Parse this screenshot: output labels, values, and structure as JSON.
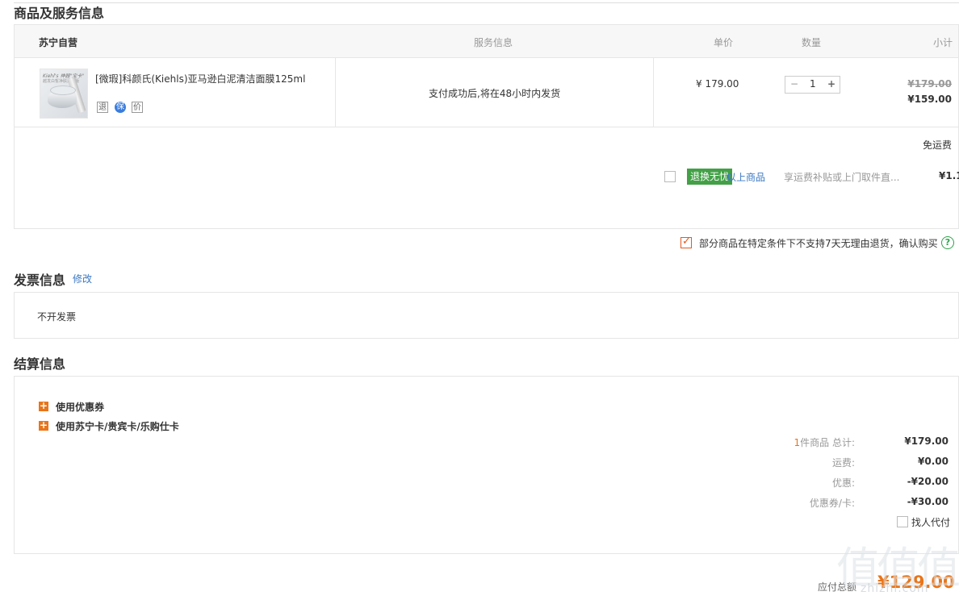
{
  "sections": {
    "goods_title": "商品及服务信息",
    "invoice_title": "发票信息",
    "invoice_edit": "修改",
    "settle_title": "结算信息"
  },
  "table": {
    "headers": [
      "苏宁自营",
      "服务信息",
      "单价",
      "数量",
      "小计"
    ]
  },
  "item": {
    "thumb_brand": "Kiehl's 神器\"宝卡\"",
    "thumb_sub": "越发白皙净肤透力版",
    "name": "[微瑕]科颜氏(Kiehls)亚马逊白泥清洁面膜125ml",
    "tags": [
      "退",
      "保",
      "价"
    ],
    "service": "支付成功后,将在48小时内发货",
    "unit_price": "¥ 179.00",
    "qty_minus": "−",
    "qty": "1",
    "qty_plus": "+",
    "orig_subtotal": "¥179.00",
    "subtotal": "¥159.00"
  },
  "freight": {
    "label": "免运费",
    "badge": "退换无忧",
    "product_link": "以上商品",
    "desc": "享运费补贴或上门取件直...",
    "price": "¥1.1"
  },
  "notice": {
    "text": "部分商品在特定条件下不支持7天无理由退货，确认购买",
    "help": "?"
  },
  "invoice": {
    "value": "不开发票"
  },
  "settle": {
    "coupon": "使用优惠券",
    "card": "使用苏宁卡/贵宾卡/乐购仕卡",
    "count_prefix": "1",
    "count_label": "件商品 总计:",
    "total": "¥179.00",
    "shipping_label": "运费:",
    "shipping": "¥0.00",
    "discount_label": "优惠:",
    "discount": "-¥20.00",
    "coupon_label": "优惠券/卡:",
    "coupon_value": "-¥30.00",
    "proxy_pay": "找人代付",
    "payable_label": "应付总额",
    "payable": "¥129.00"
  },
  "watermark": "值值值",
  "watermark_url": "zhizhi.com"
}
